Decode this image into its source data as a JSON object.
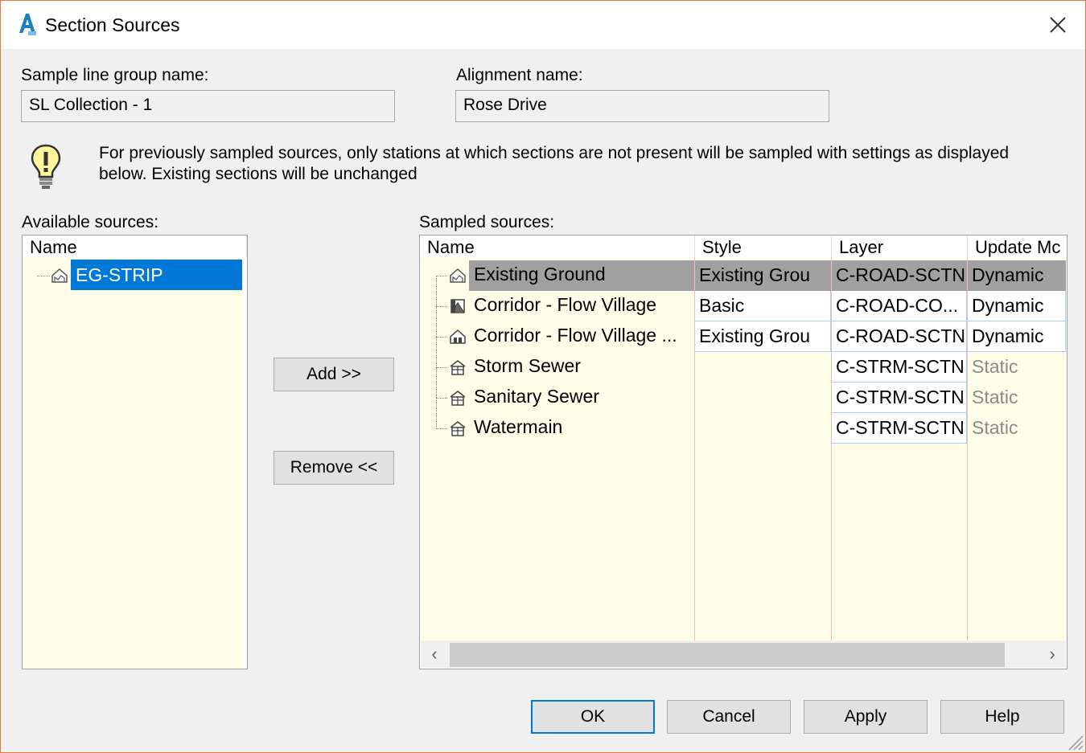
{
  "window": {
    "title": "Section Sources",
    "close_glyph": "✕"
  },
  "fields": {
    "sample_group_label": "Sample line group name:",
    "sample_group_value": "SL Collection - 1",
    "alignment_label": "Alignment name:",
    "alignment_value": "Rose Drive"
  },
  "info": {
    "icon": "lightbulb-icon",
    "line1": "For previously sampled sources, only stations at which sections are not present will be sampled with settings as displayed",
    "line2": "below. Existing sections will be unchanged"
  },
  "available": {
    "label": "Available sources:",
    "header_name": "Name",
    "items": [
      {
        "name": "EG-STRIP",
        "icon": "surface-icon",
        "selected": true
      }
    ]
  },
  "buttons": {
    "add": "Add >>",
    "remove": "Remove <<",
    "ok": "OK",
    "cancel": "Cancel",
    "apply": "Apply",
    "help": "Help"
  },
  "sampled": {
    "label": "Sampled sources:",
    "headers": {
      "name": "Name",
      "style": "Style",
      "layer": "Layer",
      "update": "Update Mc"
    },
    "rows": [
      {
        "name": "Existing Ground",
        "icon": "surface-icon",
        "style": "Existing Grou",
        "layer": "C-ROAD-SCTN",
        "update": "Dynamic",
        "selected": true
      },
      {
        "name": "Corridor - Flow Village",
        "icon": "corridor-icon",
        "style": "Basic",
        "layer": "C-ROAD-CO...",
        "update": "Dynamic",
        "selected": false
      },
      {
        "name": "Corridor - Flow Village ...",
        "icon": "corridor-surface-icon",
        "style": "Existing Grou",
        "layer": "C-ROAD-SCTN",
        "update": "Dynamic",
        "selected": false
      },
      {
        "name": "Storm Sewer",
        "icon": "pipe-network-icon",
        "style": "",
        "layer": "C-STRM-SCTN",
        "update": "Static",
        "selected": false
      },
      {
        "name": "Sanitary Sewer",
        "icon": "pipe-network-icon",
        "style": "",
        "layer": "C-STRM-SCTN",
        "update": "Static",
        "selected": false
      },
      {
        "name": "Watermain",
        "icon": "pipe-network-icon",
        "style": "",
        "layer": "C-STRM-SCTN",
        "update": "Static",
        "selected": false
      }
    ]
  },
  "scrollbar": {
    "left_arrow": "‹",
    "right_arrow": "›"
  }
}
